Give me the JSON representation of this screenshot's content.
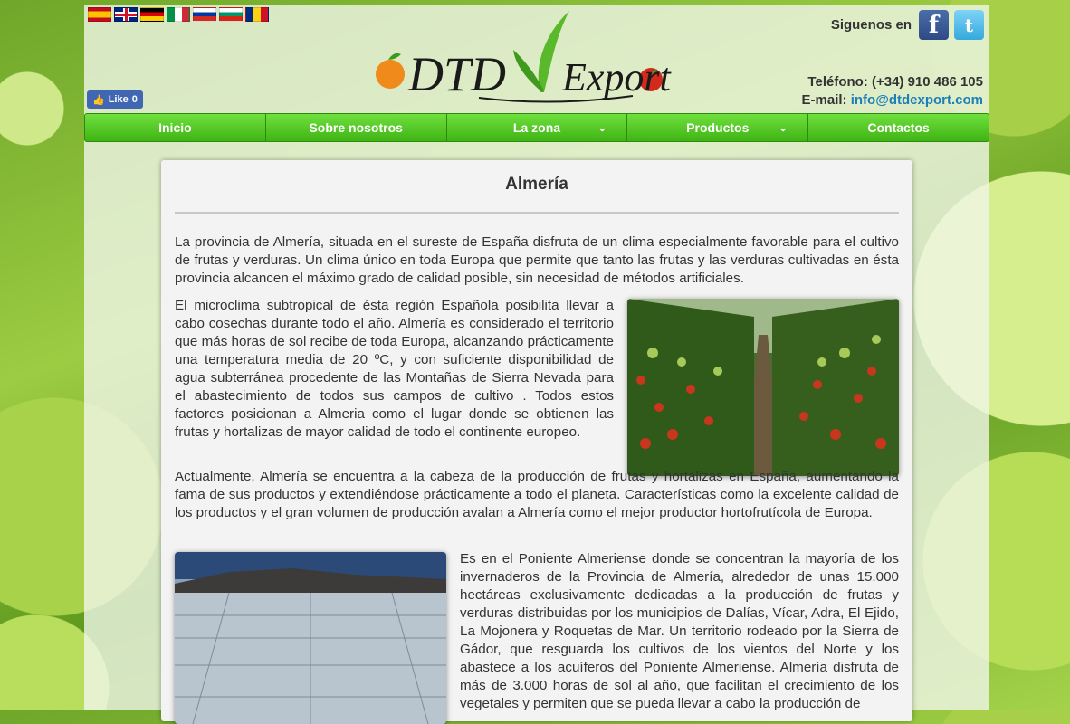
{
  "flags": [
    {
      "name": "spain-flag-icon",
      "cls": "f-es"
    },
    {
      "name": "uk-flag-icon",
      "cls": "f-gb"
    },
    {
      "name": "germany-flag-icon",
      "cls": "f-de"
    },
    {
      "name": "italy-flag-icon",
      "cls": "f-it"
    },
    {
      "name": "russia-flag-icon",
      "cls": "f-ru"
    },
    {
      "name": "bulgaria-flag-icon",
      "cls": "f-bg"
    },
    {
      "name": "romania-flag-icon",
      "cls": "f-ro"
    }
  ],
  "like": {
    "label": "Like",
    "count": "0"
  },
  "logo": {
    "dtd": "DTD",
    "export": "Export"
  },
  "social": {
    "label": "Siguenos en",
    "facebook_icon": "f",
    "twitter_icon": "t"
  },
  "contact": {
    "phone": "Teléfono: (+34) 910 486 105",
    "email_label": "E-mail:",
    "email": "info@dtdexport.com"
  },
  "nav": [
    "Inicio",
    "Sobre nosotros",
    "La zona",
    "Productos",
    "Contactos"
  ],
  "nav_chevron": "⌄",
  "page": {
    "title": "Almería",
    "p1": "La provincia de Almería, situada en el sureste de España disfruta de un clima especialmente favorable para el cultivo de frutas y verduras. Un clima único en toda Europa que permite que tanto las frutas y las verduras cultivadas en ésta provincia alcancen el máximo grado de calidad posible, sin necesidad de métodos artificiales.",
    "p2": "El microclima subtropical de ésta región Española posibilita llevar a cabo cosechas durante todo el año. Almería es considerado el territorio que más horas de sol recibe de toda Europa, alcanzando prácticamente una temperatura media de 20 ºC, y con suficiente disponibilidad de agua subterránea procedente de las Montañas de Sierra Nevada para el abastecimiento de todos sus campos de cultivo . Todos estos factores posicionan a Almeria como el lugar donde se obtienen las frutas y hortalizas de mayor calidad de todo el continente europeo.",
    "p3": "Actualmente, Almería se encuentra a la cabeza de la producción de frutas y hortalizas en España, aumentando la fama de sus productos y extendiéndose prácticamente a todo el planeta. Características como la excelente calidad de los productos y el gran volumen de producción avalan a Almería como el mejor productor hortofrutícola de Europa.",
    "p4": "Es en el Poniente Almeriense donde se concentran la mayoría de los invernaderos de la Provincia de Almería, alrededor de unas 15.000 hectáreas exclusivamente dedicadas a la producción de frutas y verduras distribuidas por los municipios de Dalías, Vícar, Adra, El Ejido, La Mojonera y Roquetas de Mar. Un territorio rodeado por la Sierra de Gádor, que resguarda los cultivos de los vientos del Norte y los abastece a los acuíferos del Poniente Almeriense. Almería disfruta de más de 3.000 horas de sol al año, que facilitan el crecimiento de los vegetales y permiten que se pueda llevar a cabo la producción de"
  }
}
